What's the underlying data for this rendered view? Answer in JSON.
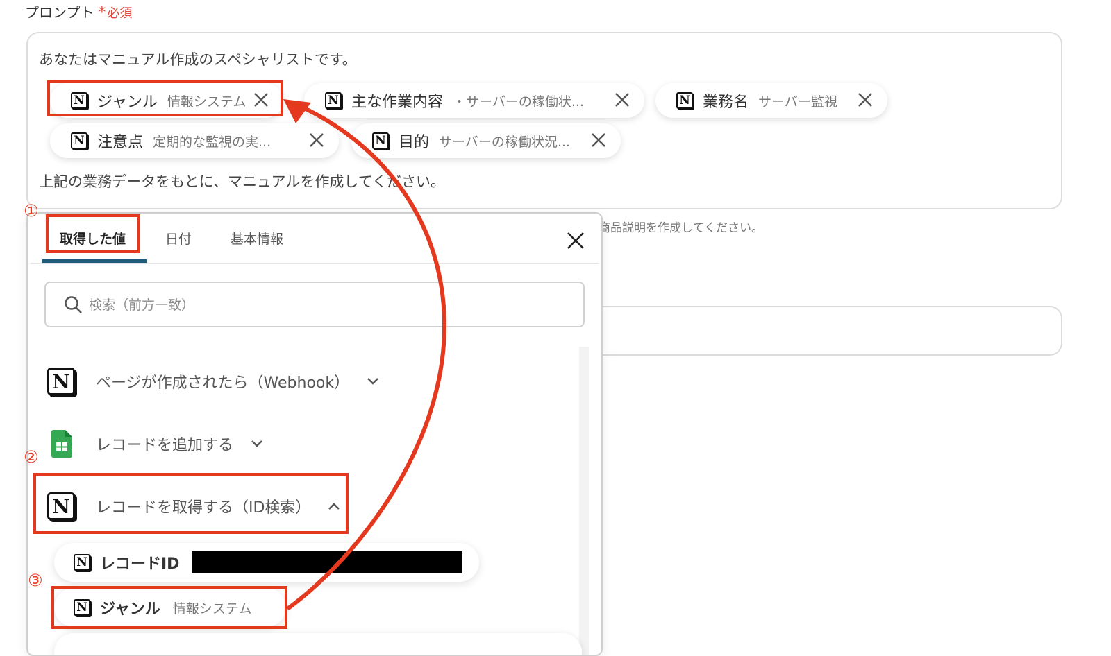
{
  "field": {
    "label": "プロンプト",
    "required_star": "*",
    "required_text": "必須"
  },
  "prompt": {
    "intro": "あなたはマニュアル作成のスペシャリストです。",
    "outro": "上記の業務データをもとに、マニュアルを作成してください。",
    "chips": [
      {
        "key": "ジャンル",
        "value": "情報システム",
        "icon": "notion-icon"
      },
      {
        "key": "主な作業内容",
        "value": "・サーバーの稼働状...",
        "icon": "notion-icon"
      },
      {
        "key": "業務名",
        "value": "サーバー監視",
        "icon": "notion-icon"
      },
      {
        "key": "注意点",
        "value": "定期的な監視の実...",
        "icon": "notion-icon"
      },
      {
        "key": "目的",
        "value": "サーバーの稼働状況...",
        "icon": "notion-icon"
      }
    ]
  },
  "hint": "商品説明を作成してください。",
  "panel": {
    "tabs": [
      "取得した値",
      "日付",
      "基本情報"
    ],
    "active_tab": "取得した値",
    "search_placeholder": "検索（前方一致）",
    "sections": [
      {
        "label": "ページが作成されたら（Webhook）",
        "icon": "notion-icon",
        "expanded": false
      },
      {
        "label": "レコードを追加する",
        "icon": "google-sheets-icon",
        "expanded": false
      },
      {
        "label": "レコードを取得する（ID検索）",
        "icon": "notion-icon",
        "expanded": true
      }
    ],
    "items": [
      {
        "key": "レコードID",
        "value": "",
        "redacted": true
      },
      {
        "key": "ジャンル",
        "value": "情報システム",
        "redacted": false
      }
    ]
  },
  "annotations": {
    "step_marks": [
      "①",
      "②",
      "③"
    ],
    "color": "#e5391f"
  },
  "colors": {
    "accent": "#1f5c7a",
    "required": "#e04a3b",
    "sheets_green": "#34a853"
  }
}
